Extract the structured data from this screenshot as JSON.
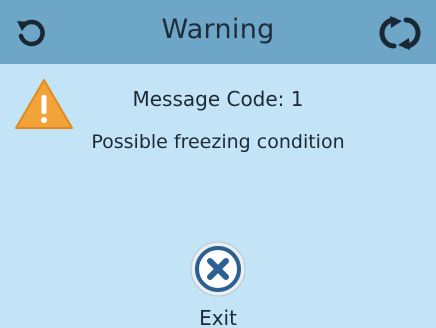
{
  "header": {
    "title": "Warning",
    "left_icon": "back-arrow-icon",
    "right_icon": "refresh-icon",
    "background_color": "#6ea6c7"
  },
  "message": {
    "warning_icon": "warning-triangle-icon",
    "code_text": "Message Code: 1",
    "body_text": "Possible freezing condition"
  },
  "footer": {
    "exit_icon": "close-circle-icon",
    "exit_label": "Exit"
  },
  "colors": {
    "screen_background": "#c2e4f6",
    "warning_orange": "#f2a33a",
    "icon_dark": "#1a2833",
    "exit_blue": "#2d5f93"
  }
}
